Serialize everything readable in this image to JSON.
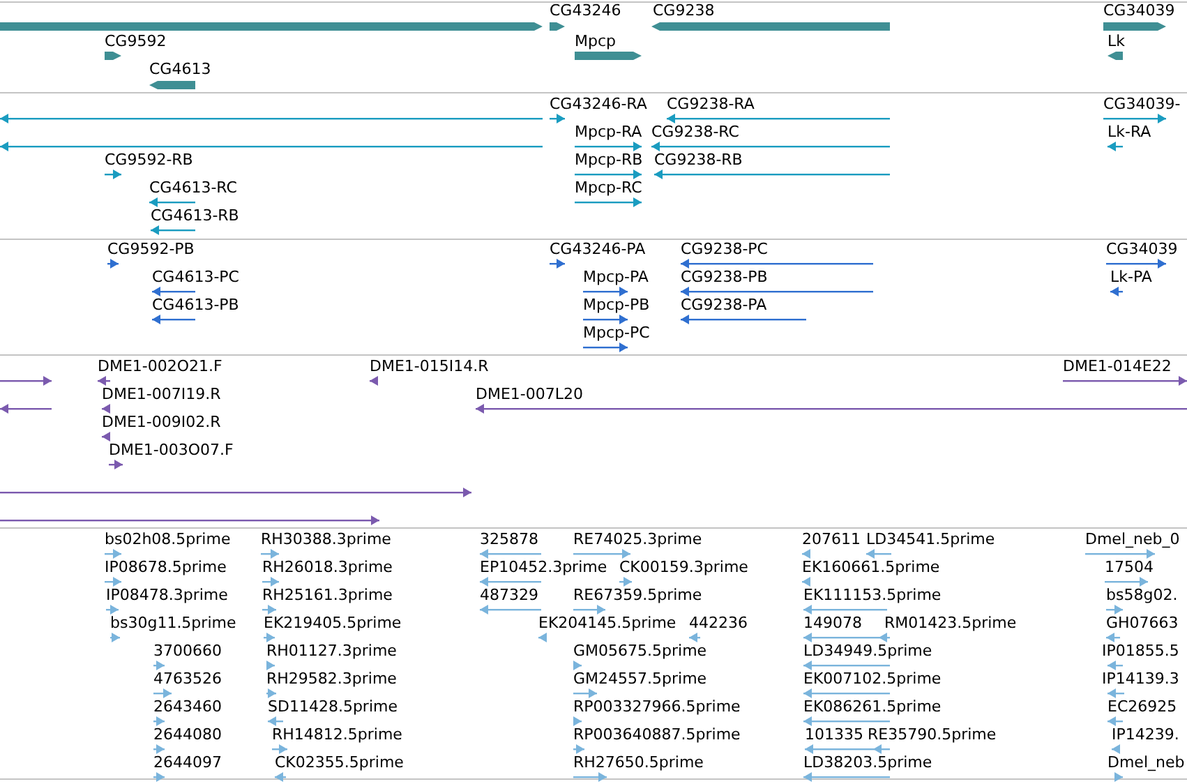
{
  "tracks": [
    {
      "kind": "gene",
      "color": "#3f8f94",
      "features": [
        {
          "reverse": false
        },
        {
          "label": "CG43246",
          "reverse": false
        },
        {
          "label": "CG9238",
          "reverse": true
        },
        {
          "label": "CG34039",
          "reverse": false
        },
        {
          "label": "CG9592",
          "reverse": false
        },
        {
          "label": "Mpcp",
          "reverse": false
        },
        {
          "label": "Lk",
          "reverse": true
        },
        {
          "label": "CG4613",
          "reverse": true
        }
      ]
    },
    {
      "kind": "transcript",
      "color": "#1a9cc0",
      "features": [
        {
          "reverse": true
        },
        {
          "label": "CG43246-RA",
          "reverse": false
        },
        {
          "label": "CG9238-RA",
          "reverse": true
        },
        {
          "label": "CG34039-",
          "reverse": false
        },
        {
          "reverse": true
        },
        {
          "label": "Mpcp-RA",
          "reverse": false
        },
        {
          "label": "CG9238-RC",
          "reverse": true
        },
        {
          "label": "Lk-RA",
          "reverse": true
        },
        {
          "label": "CG9592-RB",
          "reverse": false
        },
        {
          "label": "Mpcp-RB",
          "reverse": false
        },
        {
          "label": "CG9238-RB",
          "reverse": true
        },
        {
          "label": "CG4613-RC",
          "reverse": true
        },
        {
          "label": "Mpcp-RC",
          "reverse": false
        },
        {
          "label": "CG4613-RB",
          "reverse": true
        }
      ]
    },
    {
      "kind": "transcript",
      "color": "#2f6fd0",
      "features": [
        {
          "label": "CG9592-PB",
          "reverse": false
        },
        {
          "label": "CG43246-PA",
          "reverse": false
        },
        {
          "label": "CG9238-PC",
          "reverse": true
        },
        {
          "label": "CG34039",
          "reverse": false
        },
        {
          "label": "CG4613-PC",
          "reverse": true
        },
        {
          "label": "Mpcp-PA",
          "reverse": false
        },
        {
          "label": "CG9238-PB",
          "reverse": true
        },
        {
          "label": "Lk-PA",
          "reverse": true
        },
        {
          "label": "CG4613-PB",
          "reverse": true
        },
        {
          "label": "Mpcp-PB",
          "reverse": false
        },
        {
          "label": "CG9238-PA",
          "reverse": true
        },
        {
          "label": "Mpcp-PC",
          "reverse": false
        }
      ]
    },
    {
      "kind": "transcript",
      "color": "#7b5aae",
      "features": [
        {
          "reverse": false
        },
        {
          "label": "DME1-002O21.F",
          "reverse": true
        },
        {
          "label": "DME1-015I14.R",
          "reverse": true
        },
        {
          "label": "DME1-014E22",
          "reverse": false
        },
        {
          "reverse": true
        },
        {
          "label": "DME1-007I19.R",
          "reverse": true
        },
        {
          "label": "DME1-007L20",
          "reverse": true
        },
        {
          "label": "DME1-009I02.R",
          "reverse": true
        },
        {
          "label": "DME1-003O07.F",
          "reverse": false
        },
        {
          "reverse": false
        },
        {
          "reverse": false
        }
      ]
    },
    {
      "kind": "transcript",
      "color": "#7ab4dc",
      "features": [
        {
          "label": "bs02h08.5prime",
          "reverse": false
        },
        {
          "label": "RH30388.3prime",
          "reverse": false
        },
        {
          "label": "325878",
          "reverse": true
        },
        {
          "label": "RE74025.3prime",
          "reverse": false
        },
        {
          "label": "207611",
          "reverse": true
        },
        {
          "label": "LD34541.5prime",
          "reverse": true
        },
        {
          "label": "Dmel_neb_0",
          "reverse": false
        },
        {
          "label": "IP08678.5prime",
          "reverse": false
        },
        {
          "label": "RH26018.3prime",
          "reverse": false
        },
        {
          "label": "EP10452.3prime",
          "reverse": true
        },
        {
          "label": "CK00159.3prime",
          "reverse": false
        },
        {
          "label": "EK160661.5prime",
          "reverse": true
        },
        {
          "label": "17504",
          "reverse": false
        },
        {
          "label": "IP08478.3prime",
          "reverse": false
        },
        {
          "label": "RH25161.3prime",
          "reverse": false
        },
        {
          "label": "487329",
          "reverse": true
        },
        {
          "label": "RE67359.5prime",
          "reverse": false
        },
        {
          "label": "EK111153.5prime",
          "reverse": true
        },
        {
          "label": "bs58g02.",
          "reverse": false
        },
        {
          "label": "bs30g11.5prime",
          "reverse": false
        },
        {
          "label": "EK219405.5prime",
          "reverse": false
        },
        {
          "label": "EK204145.5prime",
          "reverse": true
        },
        {
          "label": "442236",
          "reverse": true
        },
        {
          "label": "149078",
          "reverse": true
        },
        {
          "label": "RM01423.5prime",
          "reverse": true
        },
        {
          "label": "GH07663",
          "reverse": true
        },
        {
          "label": "3700660",
          "reverse": false
        },
        {
          "label": "RH01127.3prime",
          "reverse": false
        },
        {
          "label": "GM05675.5prime",
          "reverse": false
        },
        {
          "label": "LD34949.5prime",
          "reverse": true
        },
        {
          "label": "IP01855.5",
          "reverse": true
        },
        {
          "label": "4763526",
          "reverse": false
        },
        {
          "label": "RH29582.3prime",
          "reverse": false
        },
        {
          "label": "GM24557.5prime",
          "reverse": false
        },
        {
          "label": "EK007102.5prime",
          "reverse": true
        },
        {
          "label": "IP14139.3",
          "reverse": true
        },
        {
          "label": "2643460",
          "reverse": false
        },
        {
          "label": "SD11428.5prime",
          "reverse": true
        },
        {
          "label": "RP003327966.5prime",
          "reverse": false
        },
        {
          "label": "EK086261.5prime",
          "reverse": true
        },
        {
          "label": "EC26925",
          "reverse": true
        },
        {
          "label": "2644080",
          "reverse": false
        },
        {
          "label": "RH14812.5prime",
          "reverse": false
        },
        {
          "label": "RP003640887.5prime",
          "reverse": false
        },
        {
          "label": "101335",
          "reverse": true
        },
        {
          "label": "RE35790.5prime",
          "reverse": true
        },
        {
          "label": "IP14239.",
          "reverse": true
        },
        {
          "label": "2644097",
          "reverse": false
        },
        {
          "label": "CK02355.5prime",
          "reverse": true
        },
        {
          "label": "RH27650.5prime",
          "reverse": false
        },
        {
          "label": "LD38203.5prime",
          "reverse": true
        },
        {
          "label": "Dmel_neb",
          "reverse": false
        }
      ]
    }
  ]
}
